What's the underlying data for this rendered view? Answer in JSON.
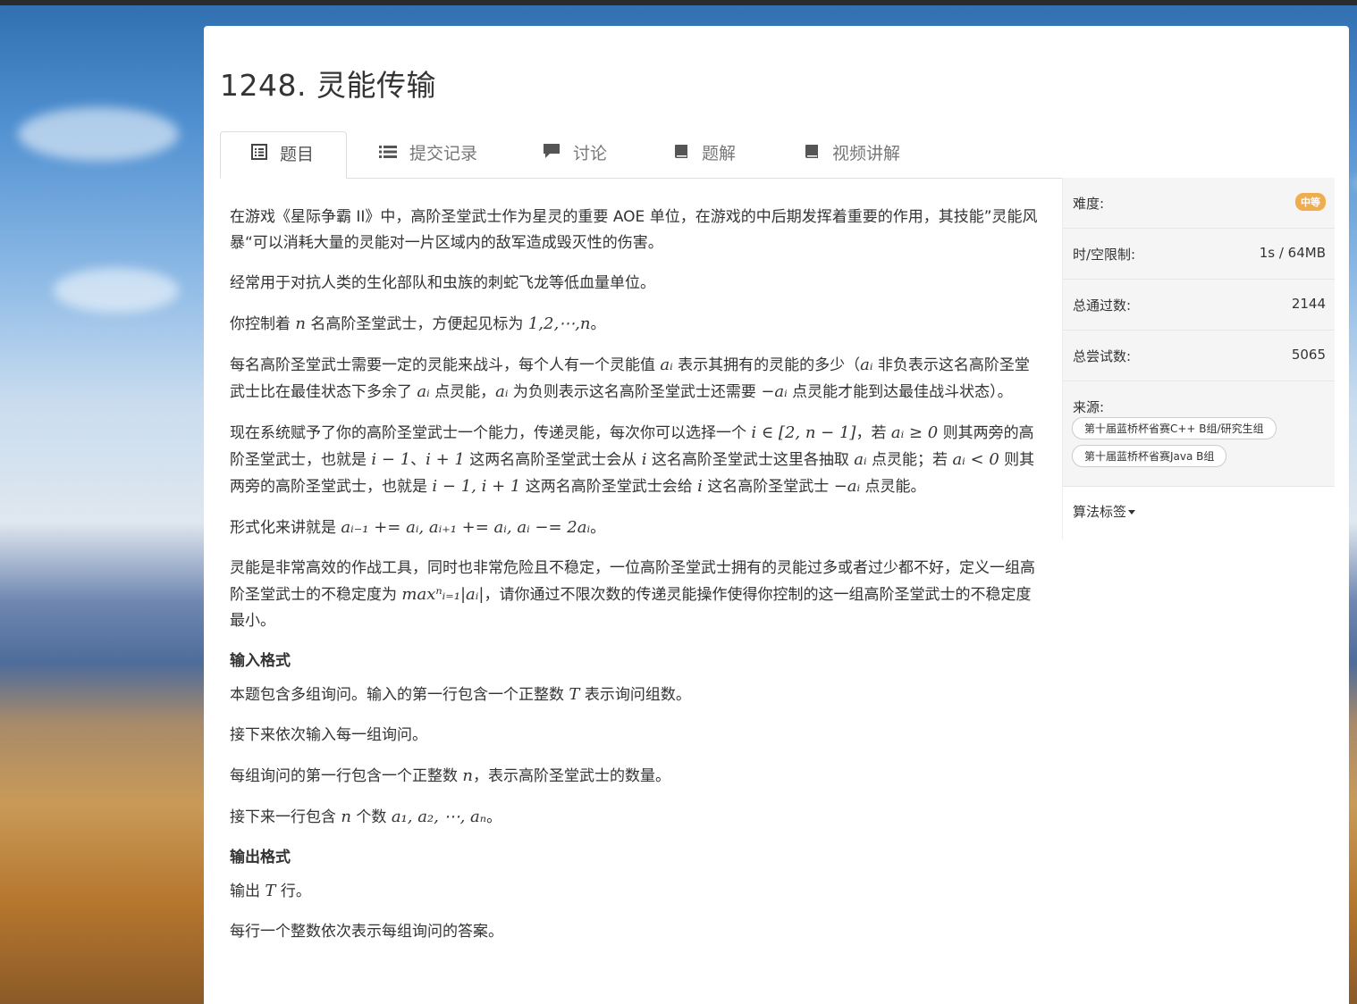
{
  "problem": {
    "title": "1248. 灵能传输"
  },
  "tabs": [
    {
      "label": "题目",
      "icon": "list-alt-icon"
    },
    {
      "label": "提交记录",
      "icon": "list-icon"
    },
    {
      "label": "讨论",
      "icon": "comment-icon"
    },
    {
      "label": "题解",
      "icon": "book-icon"
    },
    {
      "label": "视频讲解",
      "icon": "book-icon"
    }
  ],
  "sidebar": {
    "difficulty_label": "难度:",
    "difficulty_value": "中等",
    "limit_label": "时/空限制:",
    "limit_value": "1s / 64MB",
    "passed_label": "总通过数:",
    "passed_value": "2144",
    "tried_label": "总尝试数:",
    "tried_value": "5065",
    "source_label": "来源:",
    "source_tags": [
      "第十届蓝桥杯省赛C++ B组/研究生组",
      "第十届蓝桥杯省赛Java B组"
    ],
    "algo_label": "算法标签"
  },
  "colors": {
    "badge": "#f0ad4e",
    "tab_border": "#dddddd",
    "sidebar_bg": "#f5f5f5"
  },
  "statement": {
    "p1": "在游戏《星际争霸 II》中，高阶圣堂武士作为星灵的重要 AOE 单位，在游戏的中后期发挥着重要的作用，其技能”灵能风暴“可以消耗大量的灵能对一片区域内的敌军造成毁灭性的伤害。",
    "p2": "经常用于对抗人类的生化部队和虫族的刺蛇飞龙等低血量单位。",
    "p3a": "你控制着 ",
    "p3_n": "n",
    "p3b": " 名高阶圣堂武士，方便起见标为 ",
    "p3_seq": "1,2,⋯,n",
    "p3c": "。",
    "p4a": "每名高阶圣堂武士需要一定的灵能来战斗，每个人有一个灵能值 ",
    "p4_ai": "aᵢ",
    "p4b": " 表示其拥有的灵能的多少（",
    "p4_ai2": "aᵢ",
    "p4c": " 非负表示这名高阶圣堂武士比在最佳状态下多余了 ",
    "p4_ai3": "aᵢ",
    "p4d": " 点灵能，",
    "p4_ai4": "aᵢ",
    "p4e": " 为负则表示这名高阶圣堂武士还需要 ",
    "p4_neg": "−aᵢ",
    "p4f": " 点灵能才能到达最佳战斗状态）。",
    "p5a": "现在系统赋予了你的高阶圣堂武士一个能力，传递灵能，每次你可以选择一个 ",
    "p5_range": "i ∈ [2, n − 1]",
    "p5b": "，若 ",
    "p5_ge": "aᵢ ≥ 0",
    "p5c": " 则其两旁的高阶圣堂武士，也就是 ",
    "p5_im1": "i − 1",
    "p5d": "、",
    "p5_ip1": "i + 1",
    "p5e": " 这两名高阶圣堂武士会从 ",
    "p5_i": "i",
    "p5f": " 这名高阶圣堂武士这里各抽取 ",
    "p5_ai": "aᵢ",
    "p5g": " 点灵能；若 ",
    "p5_lt": "aᵢ < 0",
    "p5h": " 则其两旁的高阶圣堂武士，也就是 ",
    "p5_pair": "i − 1, i + 1",
    "p5i": " 这两名高阶圣堂武士会给 ",
    "p5_i2": "i",
    "p5j": " 这名高阶圣堂武士 ",
    "p5_neg": "−aᵢ",
    "p5k": " 点灵能。",
    "p6a": "形式化来讲就是 ",
    "p6_formula": "aᵢ₋₁ += aᵢ, aᵢ₊₁ += aᵢ, aᵢ −= 2aᵢ",
    "p6b": "。",
    "p7a": "灵能是非常高效的作战工具，同时也非常危险且不稳定，一位高阶圣堂武士拥有的灵能过多或者过少都不好，定义一组高阶圣堂武士的不稳定度为 ",
    "p7_formula": "maxⁿᵢ₌₁|aᵢ|",
    "p7b": "，请你通过不限次数的传递灵能操作使得你控制的这一组高阶圣堂武士的不稳定度最小。",
    "input_title": "输入格式",
    "in1a": "本题包含多组询问。输入的第一行包含一个正整数 ",
    "in1_T": "T",
    "in1b": " 表示询问组数。",
    "in2": "接下来依次输入每一组询问。",
    "in3a": "每组询问的第一行包含一个正整数 ",
    "in3_n": "n",
    "in3b": "，表示高阶圣堂武士的数量。",
    "in4a": "接下来一行包含 ",
    "in4_n": "n",
    "in4b": " 个数 ",
    "in4_seq": "a₁, a₂, ⋯, aₙ",
    "in4c": "。",
    "output_title": "输出格式",
    "out1a": "输出 ",
    "out1_T": "T",
    "out1b": " 行。",
    "out2": "每行一个整数依次表示每组询问的答案。"
  }
}
